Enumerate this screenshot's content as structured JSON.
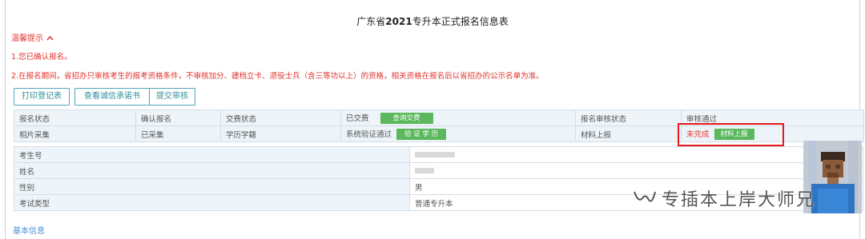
{
  "page": {
    "title_prefix": "广东省",
    "title_year": "2021",
    "title_suffix": "专升本正式报名信息表"
  },
  "tips": {
    "toggle_label": "温馨提示",
    "tip1": "1.您已确认报名。",
    "tip2": "2.在报名期间，省招办只审核考生的报考资格条件，不审核加分、建档立卡、退役士兵（含三等功以上）的资格，相关资格在报名后以省招办的公示名单为准。"
  },
  "actions": {
    "print": "打印登记表",
    "pledge": "查看诚信承诺书",
    "submit": "提交审核"
  },
  "status_table": {
    "row1": {
      "reg_status_label": "报名状态",
      "reg_status_value": "确认报名",
      "pay_status_label": "交费状态",
      "pay_status_value": "已交费",
      "pay_query_button": "查询交费",
      "review_status_label": "报名审核状态",
      "review_status_value": "审核通过"
    },
    "row2": {
      "photo_label": "相片采集",
      "photo_value": "已采集",
      "edu_label": "学历学籍",
      "edu_value": "系统验证通过",
      "edu_verify_button": "验 证 学 历",
      "material_label": "材料上报",
      "material_value": "未完成",
      "material_button": "材料上报"
    }
  },
  "info_table": {
    "rows": [
      {
        "label": "考生号",
        "value": ""
      },
      {
        "label": "姓名",
        "value": ""
      },
      {
        "label": "性别",
        "value": "男"
      },
      {
        "label": "考试类型",
        "value": "普通专升本"
      }
    ]
  },
  "section": {
    "basic_info": "基本信息"
  },
  "watermark": {
    "text": "专插本上岸大师兄"
  },
  "colors": {
    "alert_red": "#e0322b",
    "button_green": "#5cb85c",
    "outline_teal": "#4ca9b7",
    "highlight_red": "#e8181c",
    "link_blue": "#4a8fd6"
  },
  "icons": {
    "toggle": "chevron-up-icon",
    "watermark": "wechat-channel-icon"
  }
}
